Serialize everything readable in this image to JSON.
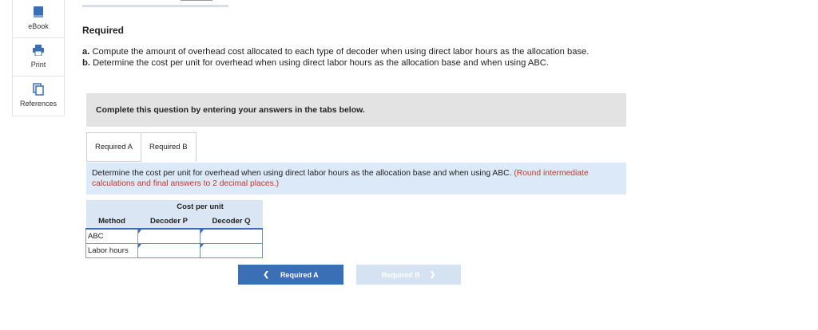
{
  "sidebar": {
    "items": [
      {
        "label": "eBook",
        "icon": "book-icon"
      },
      {
        "label": "Print",
        "icon": "printer-icon"
      },
      {
        "label": "References",
        "icon": "copy-icon"
      }
    ]
  },
  "colors": {
    "accent": "#3b6fb5",
    "instruction_bg": "#dbe9f8",
    "note_red": "#c0392b"
  },
  "required": {
    "title": "Required",
    "a_prefix": "a.",
    "a_text": "Compute the amount of overhead cost allocated to each type of decoder when using direct labor hours as the allocation base.",
    "b_prefix": "b.",
    "b_text": "Determine the cost per unit for overhead when using direct labor hours as the allocation base and when using ABC."
  },
  "complete_box": "Complete this question by entering your answers in the tabs below.",
  "tabs": [
    {
      "label": "Required A",
      "active": false
    },
    {
      "label": "Required B",
      "active": true
    }
  ],
  "instruction": {
    "text": "Determine the cost per unit for overhead when using direct labor hours as the allocation base and when using ABC.",
    "note": "(Round intermediate calculations and final answers to 2 decimal places.)"
  },
  "table": {
    "group_header": "Cost per unit",
    "columns": [
      "Method",
      "Decoder P",
      "Decoder Q"
    ],
    "rows": [
      {
        "label": "ABC",
        "values": [
          "",
          ""
        ]
      },
      {
        "label": "Labor hours",
        "values": [
          "",
          ""
        ]
      }
    ]
  },
  "nav": {
    "prev_label": "Required A",
    "next_label": "Required B"
  }
}
